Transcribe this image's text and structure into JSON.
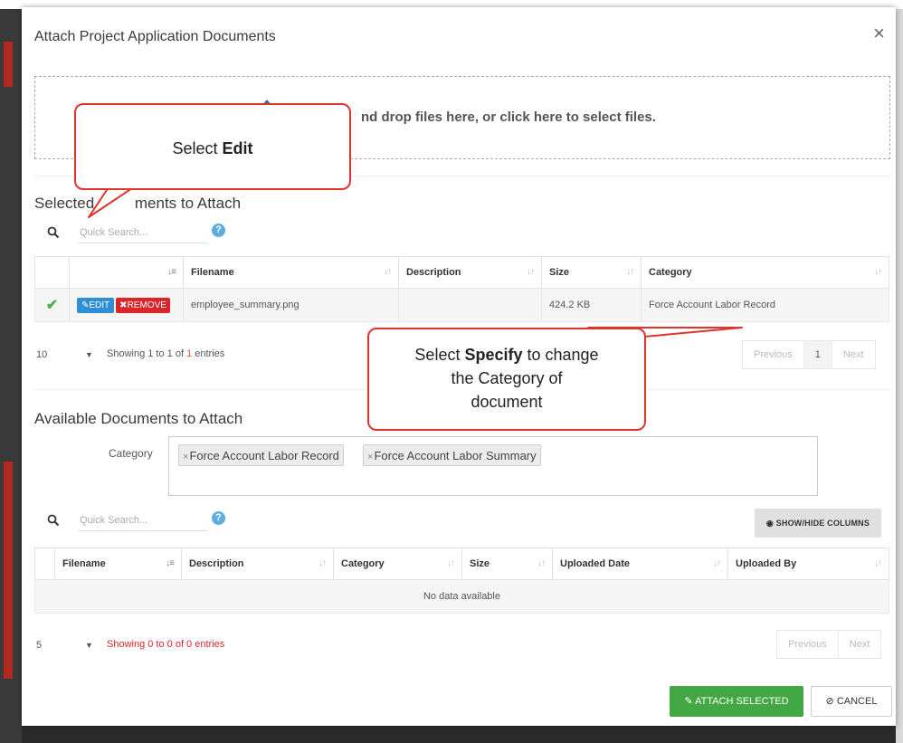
{
  "modal": {
    "title": "Attach Project Application Documents",
    "close": "×"
  },
  "dropzone": {
    "text": "nd drop files here, or click here to select files."
  },
  "selected": {
    "title_pre": "Selec",
    "title_mid": "ted ",
    "title_post": "ments to Attach",
    "search_placeholder": "Quick Search...",
    "columns": [
      "Filename",
      "Description",
      "Size",
      "Category"
    ],
    "rows": [
      {
        "edit": "EDIT",
        "remove": "REMOVE",
        "filename": "employee_summary.png",
        "description": "",
        "size": "424.2 KB",
        "category": "Force Account Labor Record"
      }
    ],
    "page_size": "10",
    "info_a": "Showing 1 to 1 of ",
    "info_num": "1",
    "info_b": " entries",
    "pager": {
      "prev": "Previous",
      "page": "1",
      "next": "Next"
    }
  },
  "available": {
    "title": "Available Documents to Attach",
    "category_label": "Category",
    "tags": [
      "Force Account Labor Record",
      "Force Account Labor Summary"
    ],
    "search_placeholder": "Quick Search...",
    "show_hide": "SHOW/HIDE COLUMNS",
    "columns": [
      "Filename",
      "Description",
      "Category",
      "Size",
      "Uploaded Date",
      "Uploaded By"
    ],
    "no_data": "No data available",
    "page_size": "5",
    "info": "Showing 0 to 0 of 0 entries",
    "pager": {
      "prev": "Previous",
      "next": "Next"
    }
  },
  "footer": {
    "attach": "ATTACH SELECTED",
    "cancel": "CANCEL"
  },
  "callouts": {
    "edit_pre": "Select ",
    "edit_bold": "Edit",
    "specify_pre": "Select ",
    "specify_bold": "Specify",
    "specify_post_1": " to change",
    "specify_line_2": "the Category of",
    "specify_line_3": "document"
  },
  "colors": {
    "edit_button": "#2f8fd6",
    "remove_button": "#d9262a",
    "attach_button": "#43a843",
    "callout_border": "#e0342a"
  }
}
